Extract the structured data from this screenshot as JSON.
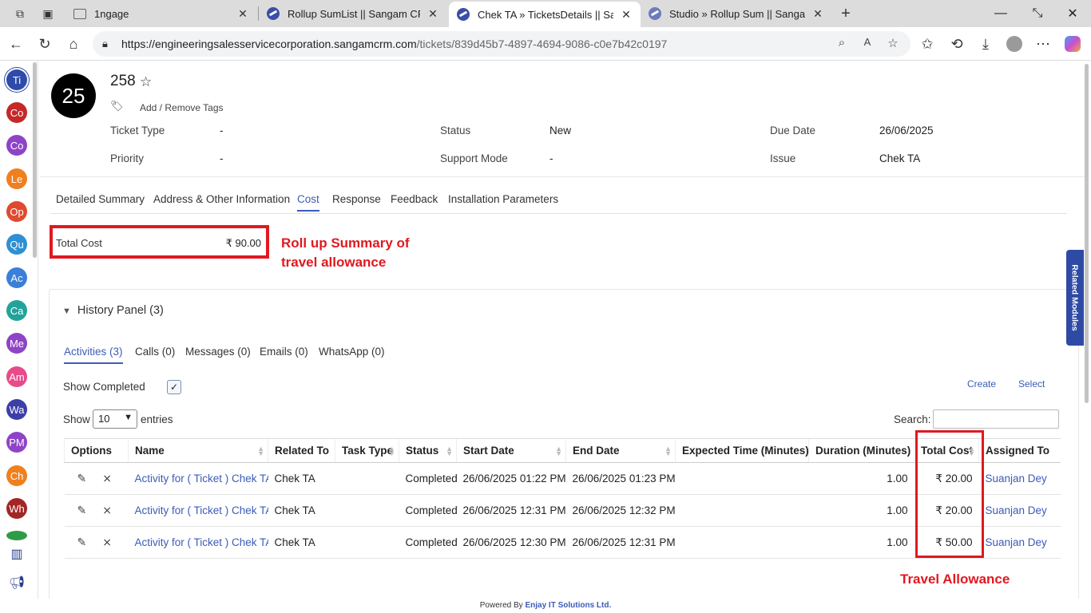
{
  "browser": {
    "tabs": [
      {
        "title": "1ngage"
      },
      {
        "title": "Rollup SumList || Sangam CRM"
      },
      {
        "title": "Chek TA » TicketsDetails || Sangam"
      },
      {
        "title": "Studio » Rollup Sum || Sangam CR"
      }
    ],
    "new_tab": "+",
    "url_host": "https://engineeringsalesservicecorporation.sangamcrm.com",
    "url_path": "/tickets/839d45b7-4897-4694-9086-c0e7b42c0197"
  },
  "rail": {
    "items": [
      "Ti",
      "Co",
      "Co",
      "Le",
      "Op",
      "Qu",
      "Ac",
      "Ca",
      "Me",
      "Am",
      "Wa",
      "PM",
      "Ch",
      "Wh"
    ],
    "colors": [
      "#2f4aa8",
      "#c62828",
      "#8e44c7",
      "#f07f1f",
      "#e04a2f",
      "#2e8fd4",
      "#3a7fd8",
      "#22a39a",
      "#8e44c7",
      "#e84a8a",
      "#3c3fa8",
      "#8e44c7",
      "#f07f1f",
      "#a32626"
    ]
  },
  "record": {
    "avatar": "25",
    "title": "258",
    "tags_link": "Add / Remove Tags",
    "fields": [
      {
        "label": "Ticket Type",
        "value": "-"
      },
      {
        "label": "Priority",
        "value": "-"
      },
      {
        "label": "Status",
        "value": "New"
      },
      {
        "label": "Support Mode",
        "value": "-"
      },
      {
        "label": "Due Date",
        "value": "26/06/2025"
      },
      {
        "label": "Issue",
        "value": "Chek TA"
      }
    ]
  },
  "content_tabs": [
    "Detailed Summary",
    "Address & Other Information",
    "Cost",
    "Response",
    "Feedback",
    "Installation Parameters"
  ],
  "cost": {
    "label": "Total Cost",
    "value": "₹ 90.00"
  },
  "annotations": {
    "rollup_line1": "Roll up Summary of",
    "rollup_line2": "travel allowance",
    "travel": "Travel Allowance"
  },
  "history": {
    "title": "History Panel (3)",
    "tabs": [
      "Activities (3)",
      "Calls (0)",
      "Messages (0)",
      "Emails (0)",
      "WhatsApp (0)"
    ],
    "show_completed": "Show Completed",
    "create": "Create",
    "select": "Select",
    "show": "Show",
    "page_size": "10",
    "entries": "entries",
    "search": "Search:",
    "columns": [
      "Options",
      "Name",
      "Related To",
      "Task Type",
      "Status",
      "Start Date",
      "End Date",
      "Expected Time (Minutes)",
      "Duration (Minutes)",
      "Total Cost",
      "Assigned To"
    ],
    "rows": [
      {
        "name": "Activity for ( Ticket ) Chek TA",
        "related": "Chek TA",
        "task_type": "",
        "status": "Completed",
        "start": "26/06/2025 01:22 PM",
        "end": "26/06/2025 01:23 PM",
        "expected": "",
        "duration": "1.00",
        "cost": "₹ 20.00",
        "assigned": "Suanjan Dey"
      },
      {
        "name": "Activity for ( Ticket ) Chek TA",
        "related": "Chek TA",
        "task_type": "",
        "status": "Completed",
        "start": "26/06/2025 12:31 PM",
        "end": "26/06/2025 12:32 PM",
        "expected": "",
        "duration": "1.00",
        "cost": "₹ 20.00",
        "assigned": "Suanjan Dey"
      },
      {
        "name": "Activity for ( Ticket ) Chek TA",
        "related": "Chek TA",
        "task_type": "",
        "status": "Completed",
        "start": "26/06/2025 12:30 PM",
        "end": "26/06/2025 12:31 PM",
        "expected": "",
        "duration": "1.00",
        "cost": "₹ 50.00",
        "assigned": "Suanjan Dey"
      }
    ]
  },
  "related_modules": "Related Modules",
  "footer": {
    "prefix": "Powered By",
    "company": "Enjay IT Solutions Ltd."
  }
}
